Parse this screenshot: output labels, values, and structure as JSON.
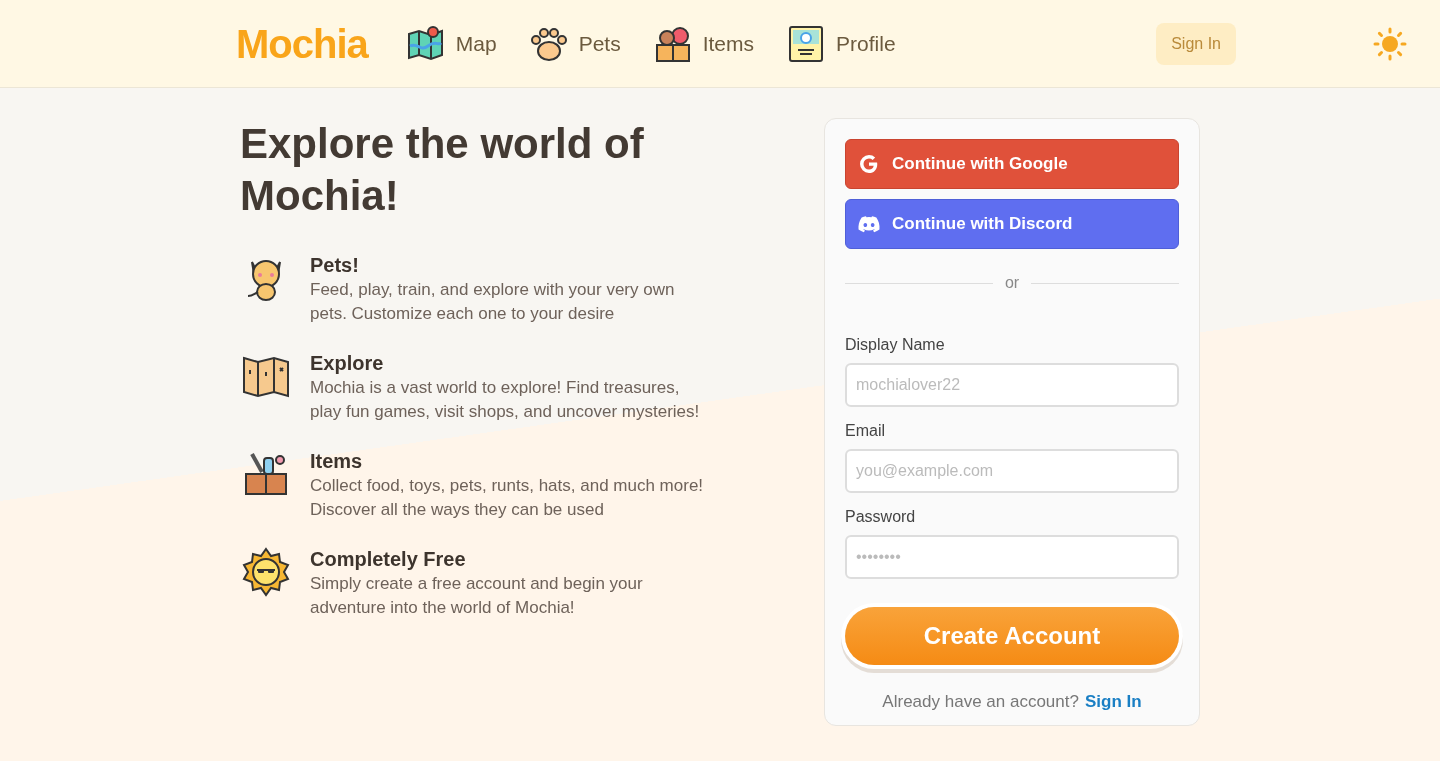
{
  "header": {
    "logo": "Mochia",
    "nav": [
      {
        "label": "Map"
      },
      {
        "label": "Pets"
      },
      {
        "label": "Items"
      },
      {
        "label": "Profile"
      }
    ],
    "sign_in": "Sign In"
  },
  "hero": {
    "title": "Explore the world of Mochia!",
    "features": [
      {
        "title": "Pets!",
        "text": "Feed, play, train, and explore with your very own pets. Customize each one to your desire"
      },
      {
        "title": "Explore",
        "text": "Mochia is a vast world to explore! Find treasures, play fun games, visit shops, and uncover mysteries!"
      },
      {
        "title": "Items",
        "text": "Collect food, toys, pets, runts, hats, and much more! Discover all the ways they can be used"
      },
      {
        "title": "Completely Free",
        "text": "Simply create a free account and begin your adventure into the world of Mochia!"
      }
    ]
  },
  "signup": {
    "google": "Continue with Google",
    "discord": "Continue with Discord",
    "divider": "or",
    "fields": [
      {
        "label": "Display Name",
        "placeholder": "mochialover22"
      },
      {
        "label": "Email",
        "placeholder": "you@example.com"
      },
      {
        "label": "Password",
        "placeholder": "••••••••"
      }
    ],
    "submit": "Create Account",
    "footer_text": "Already have an account?",
    "footer_link": "Sign In"
  }
}
